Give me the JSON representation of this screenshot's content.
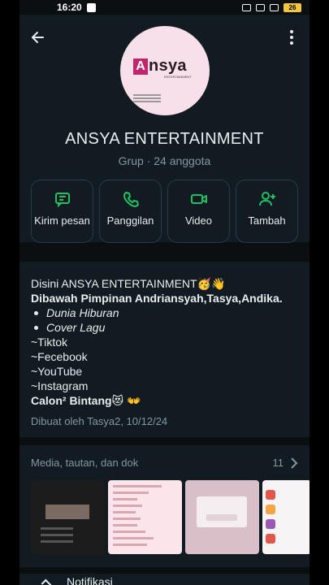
{
  "status_bar": {
    "time": "16:20",
    "battery": "26"
  },
  "group": {
    "avatar_logo_letter": "A",
    "avatar_logo_text": "nsya",
    "avatar_logo_sub": "ENTERTAINMENT",
    "name": "ANSYA ENTERTAINMENT",
    "meta": "Grup · 24 anggota"
  },
  "actions": [
    {
      "label": "Kirim pesan",
      "icon": "message-icon"
    },
    {
      "label": "Panggilan",
      "icon": "phone-icon"
    },
    {
      "label": "Video",
      "icon": "video-icon"
    },
    {
      "label": "Tambah",
      "icon": "add-person-icon"
    }
  ],
  "description": {
    "line1": "Disini ANSYA ENTERTAINMENT🥳👋",
    "line2": "Dibawah Pimpinan Andriansyah,Tasya,Andika.",
    "bullet1": "Dunia Hiburan",
    "bullet2": "Cover Lagu",
    "line3": "~Tiktok",
    "line4": "~Fecebook",
    "line5": "~YouTube",
    "line6": "~Instagram",
    "line7": "Calon² Bintang😻 👐",
    "created": "Dibuat oleh Tasya2, 10/12/24"
  },
  "media": {
    "title": "Media, tautan, dan dok",
    "count": "11"
  },
  "notifications": {
    "label": "Notifikasi"
  },
  "colors": {
    "accent": "#21c063",
    "panel": "#111b21",
    "muted": "#8696a0"
  }
}
